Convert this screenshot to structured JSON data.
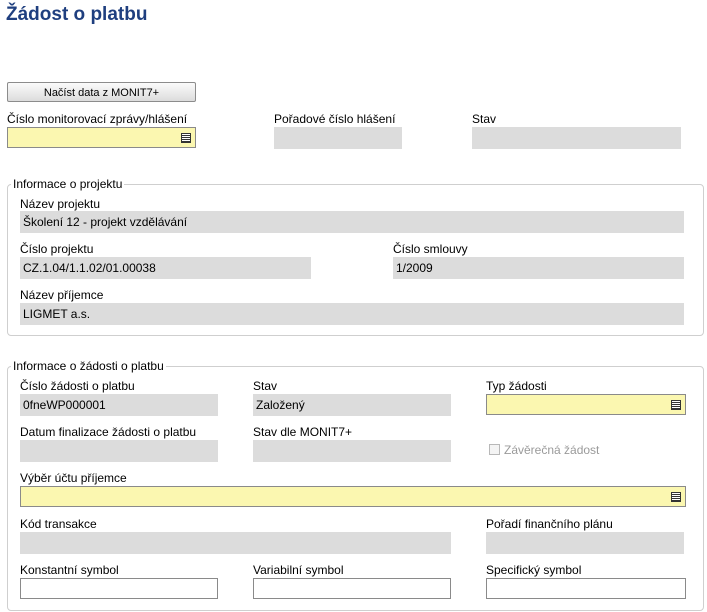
{
  "page": {
    "title": "Žádost o platbu",
    "load_button_label": "Načíst data z MONIT7+"
  },
  "top": {
    "report_number_label": "Číslo monitorovací zprávy/hlášení",
    "report_number_value": "",
    "sequence_label": "Pořadové číslo hlášení",
    "sequence_value": "",
    "state_label": "Stav",
    "state_value": ""
  },
  "project": {
    "legend": "Informace o projektu",
    "name_label": "Název projektu",
    "name_value": "Školení 12 - projekt vzdělávání",
    "number_label": "Číslo projektu",
    "number_value": "CZ.1.04/1.1.02/01.00038",
    "contract_label": "Číslo smlouvy",
    "contract_value": "1/2009",
    "recipient_label": "Název příjemce",
    "recipient_value": "LIGMET a.s."
  },
  "payment": {
    "legend": "Informace o žádosti o platbu",
    "request_number_label": "Číslo žádosti o platbu",
    "request_number_value": "0fneWP000001",
    "state_label": "Stav",
    "state_value": "Založený",
    "type_label": "Typ žádosti",
    "type_value": "",
    "finalization_date_label": "Datum finalizace žádosti o platbu",
    "finalization_date_value": "",
    "monit_state_label": "Stav dle MONIT7+",
    "monit_state_value": "",
    "final_request_label": "Závěrečná žádost",
    "final_request_checked": false,
    "account_label": "Výběr účtu příjemce",
    "account_value": "",
    "transaction_code_label": "Kód transakce",
    "transaction_code_value": "",
    "financial_plan_order_label": "Pořadí finančního plánu",
    "financial_plan_order_value": "",
    "constant_symbol_label": "Konstantní symbol",
    "constant_symbol_value": "",
    "variable_symbol_label": "Variabilní symbol",
    "variable_symbol_value": "",
    "specific_symbol_label": "Specifický symbol",
    "specific_symbol_value": ""
  },
  "colors": {
    "title": "#1f3f7f",
    "readonly_field": "#dcdcdc",
    "required_field": "#fbf7b0"
  }
}
